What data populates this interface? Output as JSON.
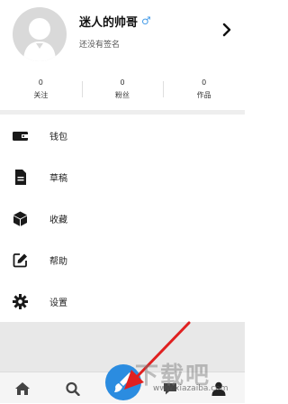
{
  "profile": {
    "username": "迷人的帅哥",
    "gender_symbol": "♂",
    "signature": "还没有签名"
  },
  "stats": [
    {
      "value": "0",
      "label": "关注"
    },
    {
      "value": "0",
      "label": "粉丝"
    },
    {
      "value": "0",
      "label": "作品"
    }
  ],
  "menu": [
    {
      "label": "钱包",
      "icon": "wallet-icon"
    },
    {
      "label": "草稿",
      "icon": "document-icon"
    },
    {
      "label": "收藏",
      "icon": "cube-icon"
    },
    {
      "label": "帮助",
      "icon": "edit-icon"
    },
    {
      "label": "设置",
      "icon": "gear-icon"
    }
  ],
  "tabbar": {
    "items": [
      "home-icon",
      "search-icon",
      "brush-icon",
      "chat-icon",
      "user-icon"
    ]
  },
  "watermark": {
    "big": "下载吧",
    "small": "www.xiazaiba.com"
  },
  "colors": {
    "accent": "#2b8ce0",
    "gender": "#4a9ee8",
    "arrow": "#e02020"
  }
}
